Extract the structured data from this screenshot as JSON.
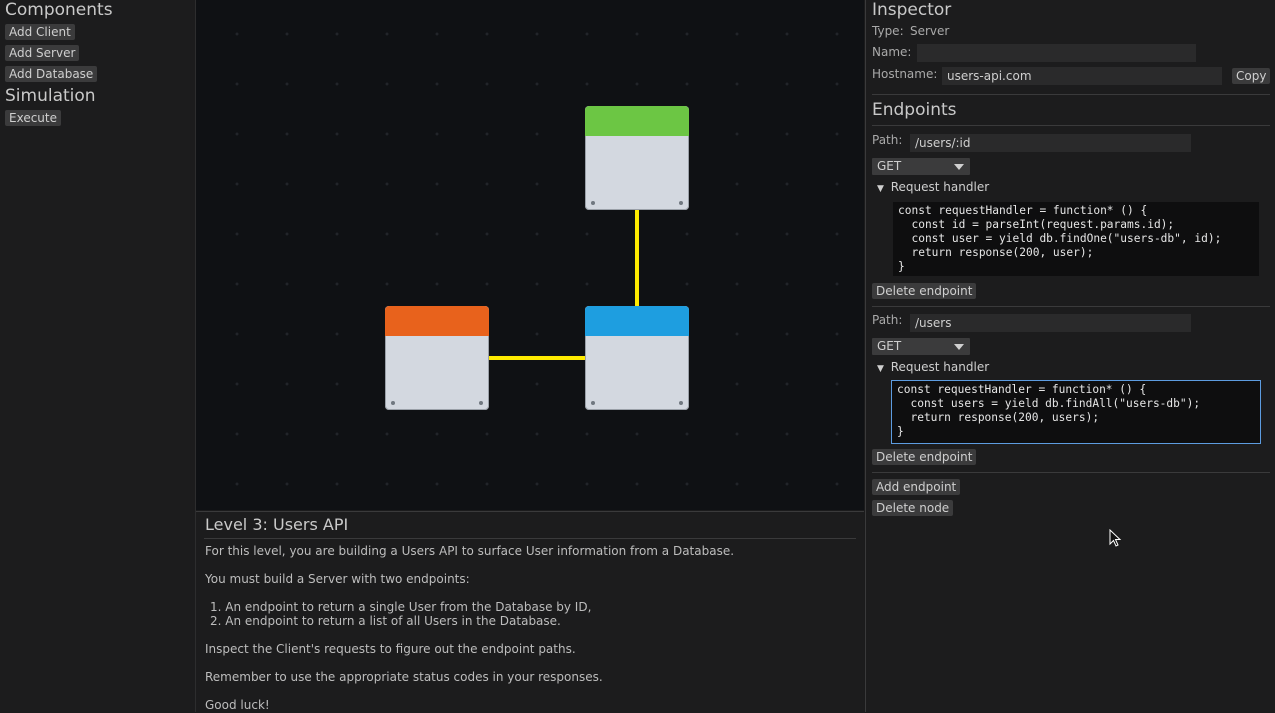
{
  "left_panel": {
    "components_heading": "Components",
    "add_client": "Add Client",
    "add_server": "Add Server",
    "add_database": "Add Database",
    "simulation_heading": "Simulation",
    "execute": "Execute"
  },
  "canvas": {
    "colors": {
      "client": "#6cc644",
      "server": "#1e9ee0",
      "database": "#e8621c",
      "connection": "#ffeb00"
    }
  },
  "level": {
    "title": "Level 3: Users API",
    "intro": "For this level, you are building a Users API to surface User information from a Database.",
    "must": "You must build a Server with two endpoints:",
    "items": [
      "1.  An endpoint to return a single User from the Database by ID,",
      "2.  An endpoint to return a list of all Users in the Database."
    ],
    "inspect": "Inspect the Client's requests to figure out the endpoint paths.",
    "remember": "Remember to use the appropriate status codes in your responses.",
    "luck": "Good luck!"
  },
  "inspector": {
    "heading": "Inspector",
    "type_label": "Type:",
    "type_value": "Server",
    "name_label": "Name:",
    "name_value": "",
    "hostname_label": "Hostname:",
    "hostname_value": "users-api.com",
    "copy": "Copy",
    "endpoints_heading": "Endpoints",
    "path_label": "Path:",
    "handler_label": "Request handler",
    "endpoints": [
      {
        "path": "/users/:id",
        "method": "GET",
        "code": "const requestHandler = function* () {\n  const id = parseInt(request.params.id);\n  const user = yield db.findOne(\"users-db\", id);\n  return response(200, user);\n}",
        "delete": "Delete endpoint"
      },
      {
        "path": "/users",
        "method": "GET",
        "code": "const requestHandler = function* () {\n  const users = yield db.findAll(\"users-db\");\n  return response(200, users);\n}",
        "delete": "Delete endpoint"
      }
    ],
    "add_endpoint": "Add endpoint",
    "delete_node": "Delete node"
  }
}
